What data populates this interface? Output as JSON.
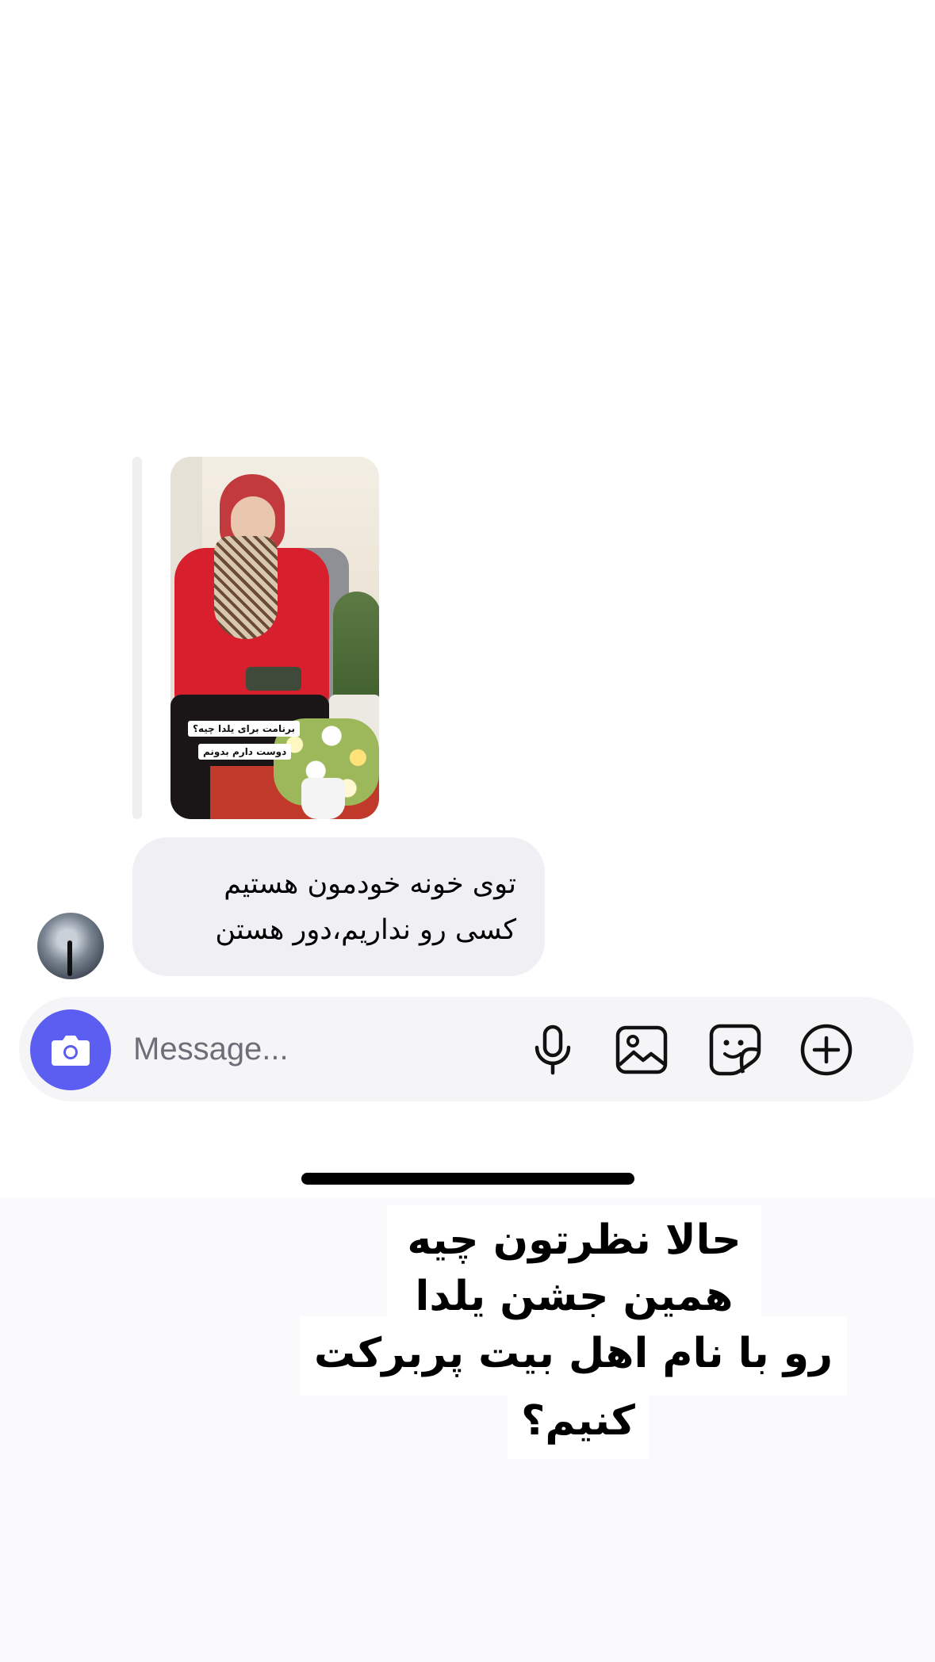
{
  "story_reply": {
    "tag_line_1": "برنامت برای یلدا چیه؟",
    "tag_line_2": "دوست دارم بدونم"
  },
  "message": {
    "line_1": "توی خونه خودمون هستیم",
    "line_2": "کسی رو نداریم،دور هستن"
  },
  "composer": {
    "placeholder": "Message...",
    "accent_color": "#5b5ef0"
  },
  "caption": {
    "line_1": "حالا نظرتون چیه",
    "line_2": "همین  جشن یلدا",
    "line_3": "رو با نام اهل بیت پربرکت",
    "line_4": "کنیم؟"
  }
}
